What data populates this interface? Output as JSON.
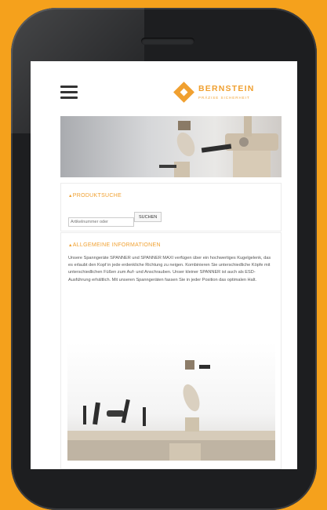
{
  "logo": {
    "name": "BERNSTEIN",
    "tagline": "PRÄZISE SICHERHEIT"
  },
  "search_section": {
    "title": "PRODUKTSUCHE",
    "input_placeholder": "Artikelnummer oder",
    "button_label": "SUCHEN"
  },
  "info_section": {
    "title": "ALLGEMEINE INFORMATIONEN",
    "text": "Unsere Spanngeräte SPANNER und SPANNER MAXI verfügen über ein hochwertiges Kugelgelenk, das es erlaubt den Kopf in jede erdenkliche Richtung zu neigen. Kombinieren Sie unterschiedliche Köpfe mit unterschiedlichen Füßen zum Auf- und Anschrauben. Unser kleiner SPANNER ist auch als ESD-Ausführung erhältlich. Mit unseren Spanngeräten fassen Sie in jeder Position das optimalen Halt."
  },
  "colors": {
    "background": "#f5a11c",
    "accent": "#f0a030",
    "phone_body": "#1d1e20"
  },
  "icons": [
    "hamburger-menu-icon",
    "bernstein-logo-icon"
  ]
}
